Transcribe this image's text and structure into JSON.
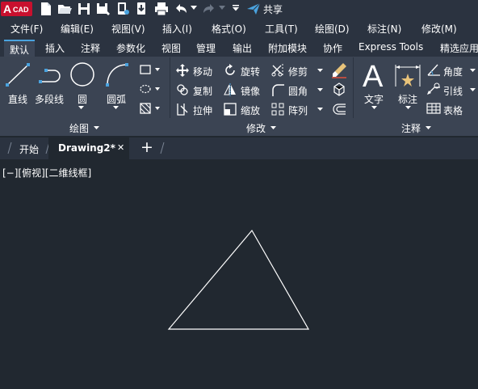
{
  "app": {
    "logo_text": "CAD",
    "logo_letter": "A",
    "share_label": "共享"
  },
  "menu": [
    "文件(F)",
    "编辑(E)",
    "视图(V)",
    "插入(I)",
    "格式(O)",
    "工具(T)",
    "绘图(D)",
    "标注(N)",
    "修改(M)"
  ],
  "ribbon_tabs": [
    "默认",
    "插入",
    "注释",
    "参数化",
    "视图",
    "管理",
    "输出",
    "附加模块",
    "协作",
    "Express Tools",
    "精选应用"
  ],
  "draw_panel": {
    "title": "绘图",
    "tools": {
      "line": "直线",
      "polyline": "多段线",
      "circle": "圆",
      "arc": "圆弧"
    }
  },
  "modify_panel": {
    "title": "修改",
    "tools": {
      "move": "移动",
      "rotate": "旋转",
      "trim": "修剪",
      "copy": "复制",
      "mirror": "镜像",
      "fillet": "圆角",
      "stretch": "拉伸",
      "scale": "缩放",
      "array": "阵列"
    }
  },
  "annotation_panel": {
    "title": "注释",
    "tools": {
      "text": "文字",
      "dimension": "标注",
      "angular": "角度",
      "leader": "引线",
      "table": "表格"
    }
  },
  "doc_tabs": {
    "start": "开始",
    "drawing": "Drawing2*",
    "close": "✕",
    "add": "+"
  },
  "viewport": {
    "label": "[−][俯视][二维线框]"
  },
  "colors": {
    "bg_dark": "#212830",
    "ribbon": "#3b4453",
    "bar": "#2b3340",
    "accent": "#4aa3df",
    "logo_red": "#c8102e"
  }
}
